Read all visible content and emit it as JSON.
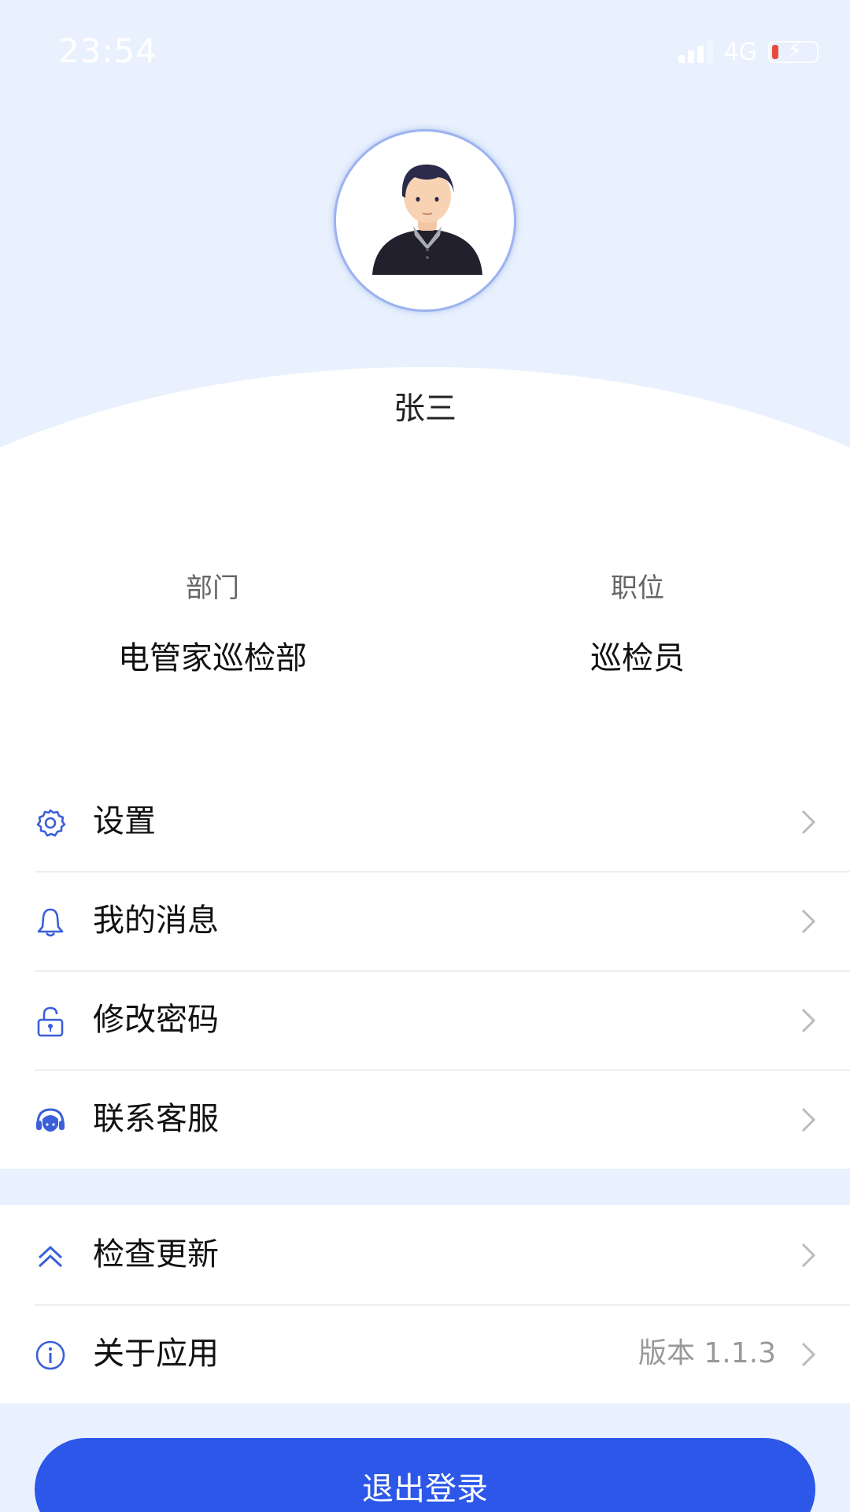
{
  "status_bar": {
    "time": "23:54",
    "network": "4G"
  },
  "profile": {
    "name": "张三",
    "department_label": "部门",
    "department_value": "电管家巡检部",
    "position_label": "职位",
    "position_value": "巡检员"
  },
  "menu_group_1": [
    {
      "label": "设置",
      "icon": "gear-icon"
    },
    {
      "label": "我的消息",
      "icon": "bell-icon"
    },
    {
      "label": "修改密码",
      "icon": "unlock-icon"
    },
    {
      "label": "联系客服",
      "icon": "headset-icon"
    }
  ],
  "menu_group_2": [
    {
      "label": "检查更新",
      "icon": "double-chevron-up-icon"
    },
    {
      "label": "关于应用",
      "icon": "info-icon",
      "value": "版本 1.1.3"
    }
  ],
  "logout": {
    "label": "退出登录"
  },
  "colors": {
    "accent": "#2c57e8",
    "background": "#e8f1fd",
    "icon": "#3a5fd9"
  }
}
